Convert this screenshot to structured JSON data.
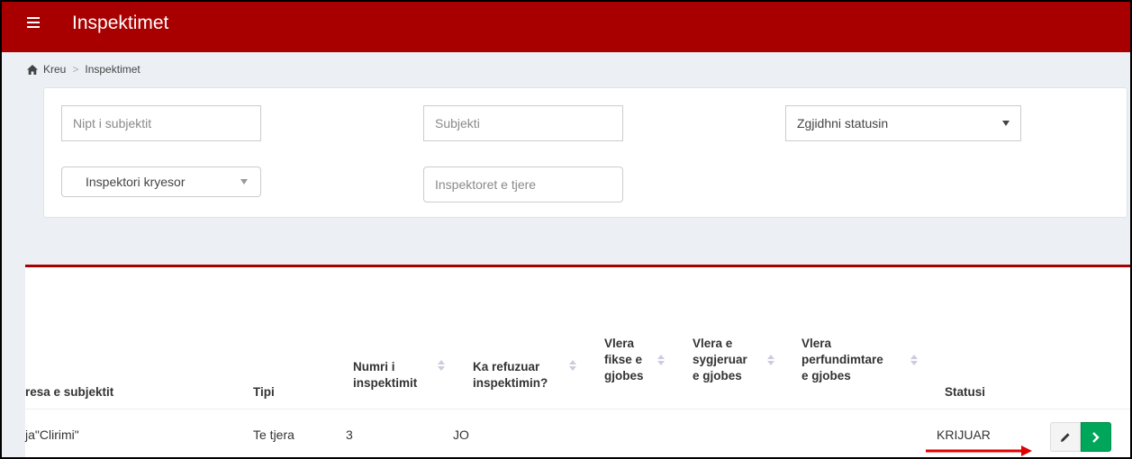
{
  "header": {
    "title": "Inspektimet",
    "menu_icon": "hamburger-icon",
    "bg_color": "#a80000"
  },
  "breadcrumb": {
    "home_icon": "home-icon",
    "home": "Kreu",
    "separator": ">",
    "current": "Inspektimet"
  },
  "filters": {
    "nipt_placeholder": "Nipt i subjektit",
    "subjekti_placeholder": "Subjekti",
    "status_select": "Zgjidhni statusin",
    "inspector_select": "Inspektori kryesor",
    "other_inspectors_placeholder": "Inspektoret e tjere"
  },
  "table": {
    "columns": {
      "adresa": "resa e subjektit",
      "tipi": "Tipi",
      "numri_1": "Numri i",
      "numri_2": "inspektimit",
      "refuz_1": "Ka refuzuar",
      "refuz_2": "inspektimin?",
      "fikse_1": "Vlera",
      "fikse_2": "fikse e",
      "fikse_3": "gjobes",
      "sygj_1": "Vlera e",
      "sygj_2": "sygjeruar",
      "sygj_3": "e gjobes",
      "perf_1": "Vlera",
      "perf_2": "perfundimtare",
      "perf_3": "e gjobes",
      "statusi": "Statusi"
    },
    "row": {
      "adresa": "ja\"Clirimi\"",
      "tipi": "Te tjera",
      "numri": "3",
      "refuzuar": "JO",
      "statusi": "KRIJUAR"
    },
    "actions": {
      "edit_icon": "pencil-icon",
      "go_icon": "chevron-right-icon",
      "go_color": "#00a65a"
    },
    "annotation": "red-arrow-icon"
  }
}
